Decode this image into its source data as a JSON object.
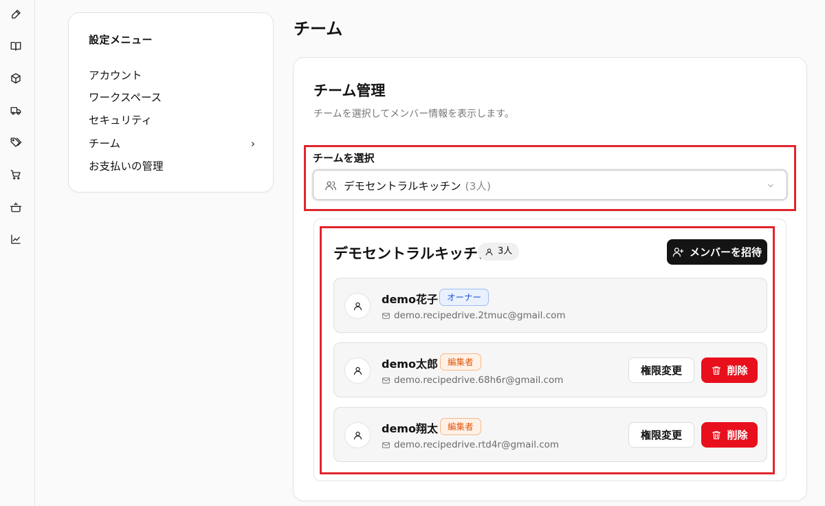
{
  "rail": {
    "icons": [
      "pen-icon",
      "book-icon",
      "box-icon",
      "truck-icon",
      "tags-icon",
      "cart-icon",
      "pot-icon",
      "chart-line-icon"
    ]
  },
  "settings_menu": {
    "title": "設定メニュー",
    "items": [
      {
        "label": "アカウント"
      },
      {
        "label": "ワークスペース"
      },
      {
        "label": "セキュリティ"
      },
      {
        "label": "チーム",
        "active": true
      },
      {
        "label": "お支払いの管理"
      }
    ],
    "active_chevron": "›"
  },
  "page": {
    "title": "チーム"
  },
  "team_card": {
    "title": "チーム管理",
    "description": "チームを選択してメンバー情報を表示します。",
    "select_label": "チームを選択",
    "selected_team": "デモセントラルキッチン",
    "selected_count": "(3人)"
  },
  "team": {
    "name": "デモセントラルキッチン",
    "member_count": "3人",
    "invite_label": "メンバーを招待",
    "members": [
      {
        "name": "demo花子",
        "role": "オーナー",
        "email": "demo.recipedrive.2tmuc@gmail.com"
      },
      {
        "name": "demo太郎",
        "role": "編集者",
        "email": "demo.recipedrive.68h6r@gmail.com",
        "perm_label": "権限変更",
        "delete_label": "削除"
      },
      {
        "name": "demo翔太",
        "role": "編集者",
        "email": "demo.recipedrive.rtd4r@gmail.com",
        "perm_label": "権限変更",
        "delete_label": "削除"
      }
    ]
  },
  "colors": {
    "highlight_box": "#e0242b",
    "delete_button": "#e8101c",
    "invite_button": "#141414",
    "owner_badge": "#1c57d8",
    "editor_badge": "#e2580d"
  }
}
